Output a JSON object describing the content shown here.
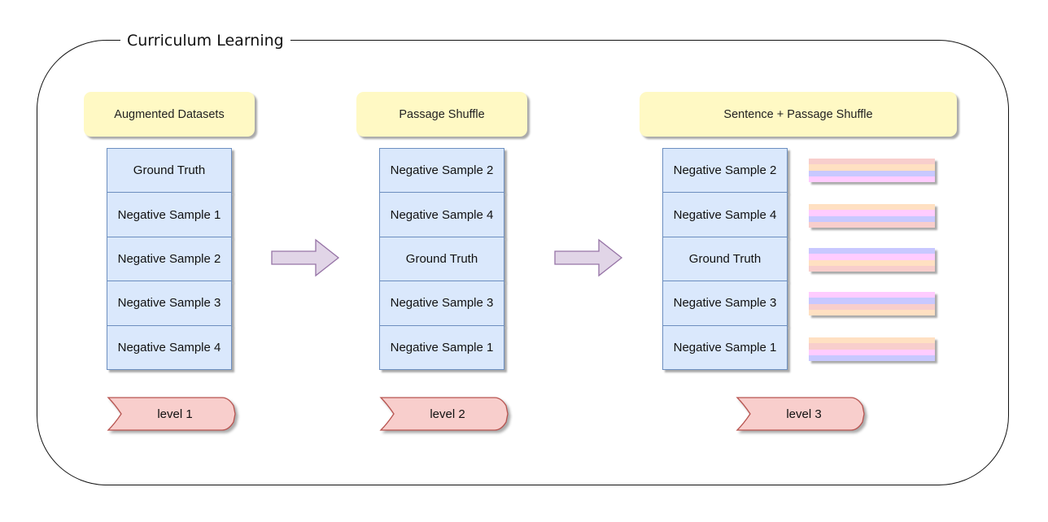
{
  "diagram": {
    "title": "Curriculum Learning",
    "stages": [
      {
        "header": "Augmented Datasets",
        "items": [
          "Ground Truth",
          "Negative Sample 1",
          "Negative Sample 2",
          "Negative Sample 3",
          "Negative Sample 4"
        ],
        "level": "level 1"
      },
      {
        "header": "Passage Shuffle",
        "items": [
          "Negative Sample 2",
          "Negative Sample 4",
          "Ground Truth",
          "Negative Sample 3",
          "Negative Sample 1"
        ],
        "level": "level 2"
      },
      {
        "header": "Sentence + Passage Shuffle",
        "items": [
          "Negative Sample 2",
          "Negative Sample 4",
          "Ground Truth",
          "Negative Sample 3",
          "Negative Sample 1"
        ],
        "level": "level 3"
      }
    ],
    "sentence_stripes": [
      [
        "#f8cecc",
        "#ffe0c2",
        "#c8c8ff",
        "#ffccff"
      ],
      [
        "#ffe0c2",
        "#ffccff",
        "#c8c8ff",
        "#f8cecc"
      ],
      [
        "#c8c8ff",
        "#ffccff",
        "#ffe0c2",
        "#f8cecc"
      ],
      [
        "#ffccff",
        "#c8c8ff",
        "#f8cecc",
        "#ffe0c2"
      ],
      [
        "#ffe0c2",
        "#f8cecc",
        "#ffccff",
        "#c8c8ff"
      ]
    ],
    "colors": {
      "header_fill": "#fff9c4",
      "item_fill": "#dae8fc",
      "item_border": "#6c8ebf",
      "arrow_fill": "#e1d5e7",
      "arrow_stroke": "#9673a6",
      "level_fill": "#f8cecc",
      "level_stroke": "#b85450"
    }
  }
}
